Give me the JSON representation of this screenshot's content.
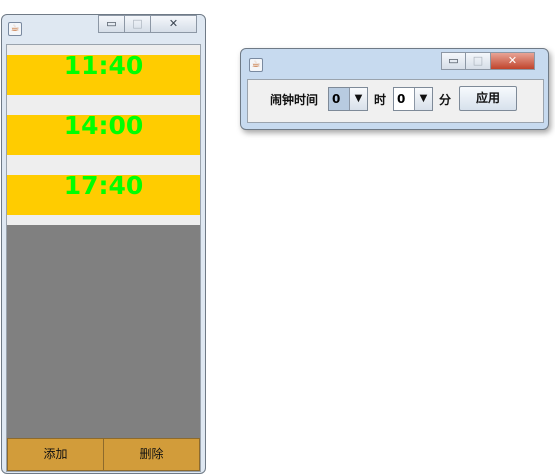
{
  "left_window": {
    "icon": "java-cup-icon",
    "controls": {
      "minimize": "▭",
      "maximize": "□",
      "close": "✕"
    },
    "alarms": [
      {
        "time": "11:40"
      },
      {
        "time": "14:00"
      },
      {
        "time": "17:40"
      }
    ],
    "buttons": {
      "add": "添加",
      "delete": "删除"
    },
    "colors": {
      "alarm_bg": "#ffcc00",
      "alarm_text": "#00ff00",
      "list_bg": "#808080",
      "button_bg": "#d29c3a"
    }
  },
  "right_window": {
    "icon": "java-cup-icon",
    "controls": {
      "minimize": "▭",
      "maximize": "□",
      "close": "✕"
    },
    "alarm_time_label": "闹钟时间",
    "hour": {
      "value": "0",
      "unit": "时"
    },
    "minute": {
      "value": "0",
      "unit": "分"
    },
    "apply_label": "应用",
    "colors": {
      "close_button": "#c0442c"
    }
  }
}
